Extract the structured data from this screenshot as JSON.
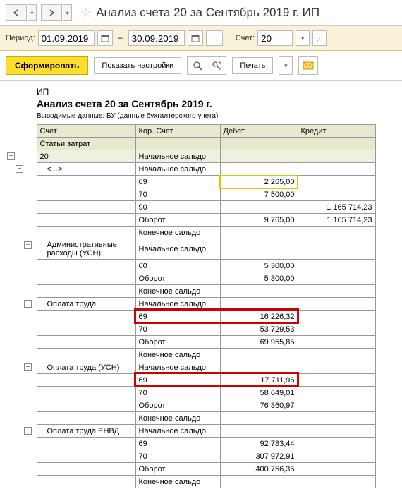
{
  "title": "Анализ счета 20 за Сентябрь 2019 г. ИП",
  "toolbar1": {
    "period_label": "Период:",
    "date_from": "01.09.2019",
    "date_to": "30.09.2019",
    "account_label": "Счет:",
    "account": "20"
  },
  "toolbar2": {
    "form": "Сформировать",
    "settings": "Показать настройки",
    "print": "Печать"
  },
  "report": {
    "org": "ИП",
    "title": "Анализ счета 20 за Сентябрь 2019 г.",
    "subtitle": "Выводимые данные: БУ (данные бухгалтерского учета)"
  },
  "headers": {
    "acct": "Счет",
    "corr": "Кор. Счет",
    "debit": "Дебет",
    "credit": "Кредит",
    "cost": "Статьи затрат"
  },
  "labels": {
    "start": "Начальное сальдо",
    "end": "Конечное сальдо",
    "turn": "Оборот"
  },
  "rows": [
    {
      "tree": "exp0",
      "acct": "20",
      "corr": "Начальное сальдо",
      "deb": "",
      "cred": "",
      "cls": "sub"
    },
    {
      "tree": "exp1",
      "acct": "<...>",
      "corr": "Начальное сальдо",
      "deb": "",
      "cred": ""
    },
    {
      "tree": "",
      "acct": "",
      "corr": "69",
      "deb": "2 265,00",
      "cred": "",
      "hlY": true
    },
    {
      "tree": "",
      "acct": "",
      "corr": "70",
      "deb": "7 500,00",
      "cred": ""
    },
    {
      "tree": "",
      "acct": "",
      "corr": "90",
      "deb": "",
      "cred": "1 165 714,23"
    },
    {
      "tree": "",
      "acct": "",
      "corr": "Оборот",
      "deb": "9 765,00",
      "cred": "1 165 714,23"
    },
    {
      "tree": "",
      "acct": "",
      "corr": "Конечное сальдо",
      "deb": "",
      "cred": ""
    },
    {
      "tree": "exp2",
      "acct": "Административные расходы (УСН)",
      "corr": "Начальное сальдо",
      "deb": "",
      "cred": ""
    },
    {
      "tree": "",
      "acct": "",
      "corr": "60",
      "deb": "5 300,00",
      "cred": ""
    },
    {
      "tree": "",
      "acct": "",
      "corr": "Оборот",
      "deb": "5 300,00",
      "cred": ""
    },
    {
      "tree": "",
      "acct": "",
      "corr": "Конечное сальдо",
      "deb": "",
      "cred": ""
    },
    {
      "tree": "exp2",
      "acct": "Оплата труда",
      "corr": "Начальное сальдо",
      "deb": "",
      "cred": ""
    },
    {
      "tree": "",
      "acct": "",
      "corr": "69",
      "deb": "16 226,32",
      "cred": "",
      "hlR": 1
    },
    {
      "tree": "",
      "acct": "",
      "corr": "70",
      "deb": "53 729,53",
      "cred": ""
    },
    {
      "tree": "",
      "acct": "",
      "corr": "Оборот",
      "deb": "69 955,85",
      "cred": ""
    },
    {
      "tree": "",
      "acct": "",
      "corr": "Конечное сальдо",
      "deb": "",
      "cred": ""
    },
    {
      "tree": "exp2",
      "acct": "Оплата труда (УСН)",
      "corr": "Начальное сальдо",
      "deb": "",
      "cred": ""
    },
    {
      "tree": "",
      "acct": "",
      "corr": "69",
      "deb": "17 711,96",
      "cred": "",
      "hlR": 2
    },
    {
      "tree": "",
      "acct": "",
      "corr": "70",
      "deb": "58 649,01",
      "cred": ""
    },
    {
      "tree": "",
      "acct": "",
      "corr": "Оборот",
      "deb": "76 360,97",
      "cred": ""
    },
    {
      "tree": "",
      "acct": "",
      "corr": "Конечное сальдо",
      "deb": "",
      "cred": ""
    },
    {
      "tree": "exp2",
      "acct": "Оплата труда ЕНВД",
      "corr": "Начальное сальдо",
      "deb": "",
      "cred": ""
    },
    {
      "tree": "",
      "acct": "",
      "corr": "69",
      "deb": "92 783,44",
      "cred": ""
    },
    {
      "tree": "",
      "acct": "",
      "corr": "70",
      "deb": "307 972,91",
      "cred": ""
    },
    {
      "tree": "",
      "acct": "",
      "corr": "Оборот",
      "deb": "400 756,35",
      "cred": ""
    },
    {
      "tree": "",
      "acct": "",
      "corr": "Конечное сальдо",
      "deb": "",
      "cred": ""
    }
  ]
}
